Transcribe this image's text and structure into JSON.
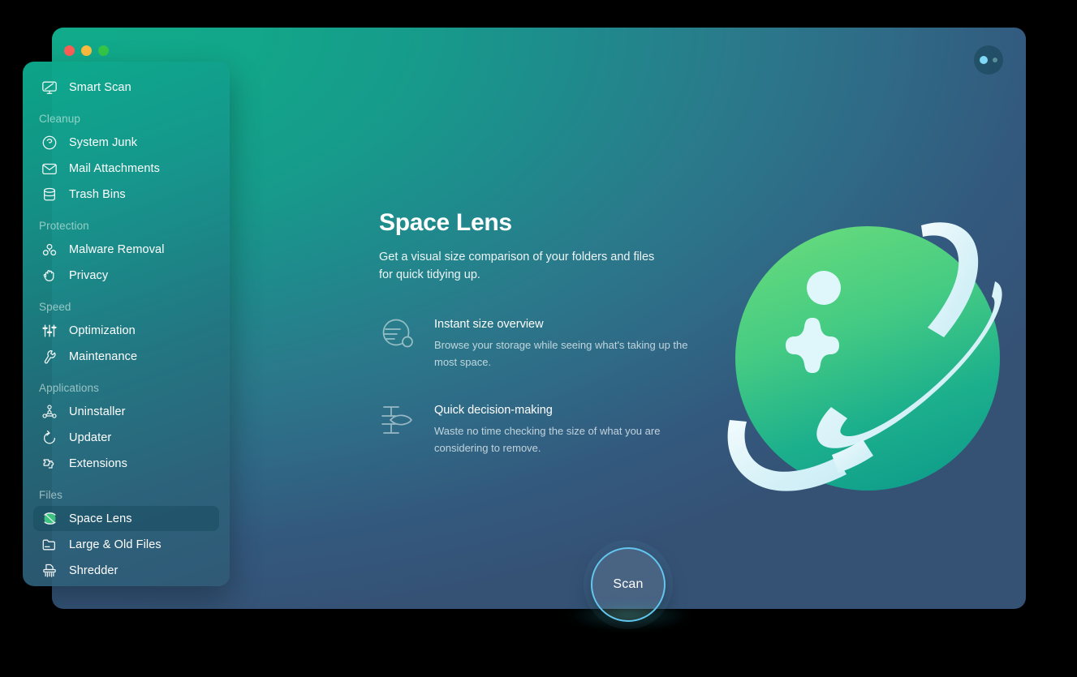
{
  "window": {
    "traffic_lights": [
      "close",
      "minimize",
      "zoom"
    ],
    "menu_button_name": "more-options"
  },
  "sidebar": {
    "groups": [
      {
        "label": "",
        "items": [
          {
            "label": "Smart Scan",
            "icon": "display-scan-icon",
            "selected": false
          }
        ]
      },
      {
        "label": "Cleanup",
        "items": [
          {
            "label": "System Junk",
            "icon": "junk-swirl-icon",
            "selected": false
          },
          {
            "label": "Mail Attachments",
            "icon": "envelope-icon",
            "selected": false
          },
          {
            "label": "Trash Bins",
            "icon": "trash-bin-icon",
            "selected": false
          }
        ]
      },
      {
        "label": "Protection",
        "items": [
          {
            "label": "Malware Removal",
            "icon": "biohazard-icon",
            "selected": false
          },
          {
            "label": "Privacy",
            "icon": "hand-stop-icon",
            "selected": false
          }
        ]
      },
      {
        "label": "Speed",
        "items": [
          {
            "label": "Optimization",
            "icon": "sliders-icon",
            "selected": false
          },
          {
            "label": "Maintenance",
            "icon": "wrench-icon",
            "selected": false
          }
        ]
      },
      {
        "label": "Applications",
        "items": [
          {
            "label": "Uninstaller",
            "icon": "app-tree-icon",
            "selected": false
          },
          {
            "label": "Updater",
            "icon": "refresh-arrow-icon",
            "selected": false
          },
          {
            "label": "Extensions",
            "icon": "puzzle-piece-icon",
            "selected": false
          }
        ]
      },
      {
        "label": "Files",
        "items": [
          {
            "label": "Space Lens",
            "icon": "planet-icon",
            "selected": true
          },
          {
            "label": "Large & Old Files",
            "icon": "folder-icon",
            "selected": false
          },
          {
            "label": "Shredder",
            "icon": "shredder-icon",
            "selected": false
          }
        ]
      }
    ]
  },
  "main": {
    "title": "Space Lens",
    "subtitle": "Get a visual size comparison of your folders and files for quick tidying up.",
    "features": [
      {
        "icon": "planet-lines-icon",
        "title": "Instant size overview",
        "description": "Browse your storage while seeing what's taking up the most space."
      },
      {
        "icon": "caliper-gauge-icon",
        "title": "Quick decision-making",
        "description": "Waste no time checking the size of what you are considering to remove."
      }
    ],
    "illustration": "space-lens-planet",
    "scan_button_label": "Scan"
  },
  "colors": {
    "accent_green": "#12a68a",
    "accent_blue": "#355275",
    "scan_ring": "#63c6ef",
    "planet_green_light": "#5ed47f",
    "planet_green_dark": "#13a086",
    "selected_row": "rgba(18,72,88,0.42)"
  }
}
